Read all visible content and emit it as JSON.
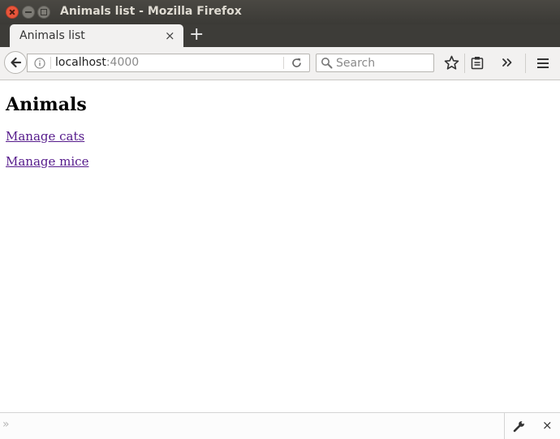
{
  "window": {
    "title": "Animals list - Mozilla Firefox"
  },
  "tab": {
    "label": "Animals list",
    "close_glyph": "×",
    "new_tab_glyph": "+"
  },
  "navbar": {
    "url_host": "localhost",
    "url_port": ":4000",
    "search_placeholder": "Search"
  },
  "page": {
    "heading": "Animals",
    "links": [
      "Manage cats",
      "Manage mice"
    ],
    "link_color": "#551a8b"
  },
  "devtools": {
    "prompt_glyph": "»",
    "close_glyph": "×"
  },
  "icons": [
    "back-arrow-icon",
    "info-icon",
    "reload-icon",
    "search-icon",
    "bookmark-star-icon",
    "reading-list-icon",
    "overflow-chevron-icon",
    "hamburger-menu-icon",
    "wrench-icon"
  ]
}
